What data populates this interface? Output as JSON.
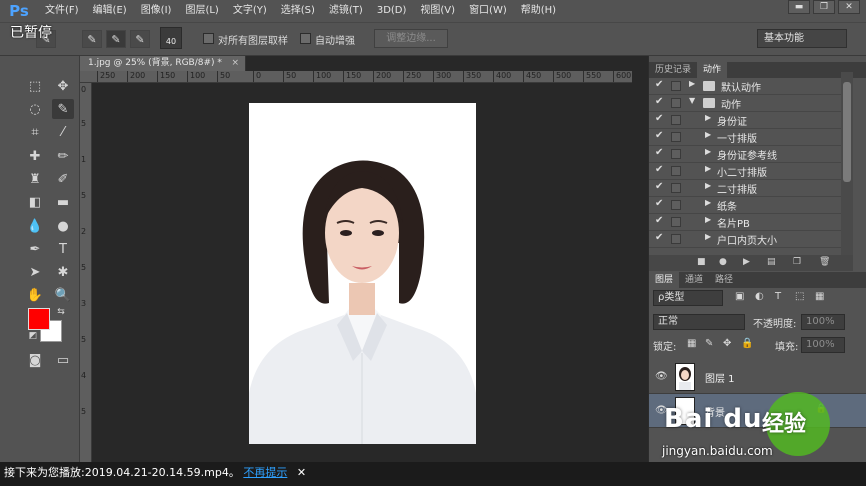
{
  "app": {
    "logo": "Ps"
  },
  "menu": [
    "文件(F)",
    "编辑(E)",
    "图像(I)",
    "图层(L)",
    "文字(Y)",
    "选择(S)",
    "滤镜(T)",
    "3D(D)",
    "视图(V)",
    "窗口(W)",
    "帮助(H)"
  ],
  "window_controls": {
    "minimize": "▬",
    "restore": "❐",
    "close": "✕"
  },
  "options_bar": {
    "brush_size": "40",
    "sample_all_layers": "对所有图层取样",
    "auto_enhance": "自动增强",
    "refine_edge": "调整边缘...",
    "workspace": "基本功能"
  },
  "overlay_status": "已暂停",
  "document": {
    "tab": "1.jpg @ 25% (背景, RGB/8#) *",
    "tab_close": "×",
    "ruler_h": [
      "250",
      "200",
      "150",
      "100",
      "50",
      "0",
      "50",
      "100",
      "150",
      "200",
      "250",
      "300",
      "350",
      "400",
      "450",
      "500",
      "550",
      "600"
    ],
    "ruler_v": [
      "0",
      "5",
      "1",
      "5",
      "2",
      "5",
      "3",
      "5",
      "4",
      "5"
    ]
  },
  "colors": {
    "foreground": "#ff0000",
    "background": "#ffffff",
    "accent": "#2ea1ff"
  },
  "panels": {
    "history_tab": "历史记录",
    "actions_tab": "动作",
    "actions": [
      {
        "label": "默认动作",
        "indent": 0,
        "type": "folder"
      },
      {
        "label": "动作",
        "indent": 0,
        "type": "folder-open"
      },
      {
        "label": "身份证",
        "indent": 1,
        "type": "action"
      },
      {
        "label": "一寸排版",
        "indent": 1,
        "type": "action"
      },
      {
        "label": "身份证参考线",
        "indent": 1,
        "type": "action"
      },
      {
        "label": "小二寸排版",
        "indent": 1,
        "type": "action"
      },
      {
        "label": "二寸排版",
        "indent": 1,
        "type": "action"
      },
      {
        "label": "纸条",
        "indent": 1,
        "type": "action"
      },
      {
        "label": "名片PB",
        "indent": 1,
        "type": "action"
      },
      {
        "label": "户口内页大小",
        "indent": 1,
        "type": "action"
      }
    ],
    "layers_tabs": [
      "图层",
      "通道",
      "路径"
    ],
    "kind_filter": "ρ类型",
    "blend_mode": "正常",
    "opacity_label": "不透明度:",
    "opacity_value": "100%",
    "lock_label": "锁定:",
    "fill_label": "填充:",
    "fill_value": "100%",
    "layers": [
      {
        "name": "图层 1",
        "selected": false
      },
      {
        "name": "背景",
        "selected": true
      }
    ]
  },
  "player": {
    "prefix": "接下来为您播放:2019.04.21-20.14.59.mp4。",
    "hint": "不再提示",
    "close": "✕"
  },
  "watermark": {
    "brand": "Bai du",
    "brand_cn": "经验",
    "url": "jingyan.baidu.com"
  }
}
